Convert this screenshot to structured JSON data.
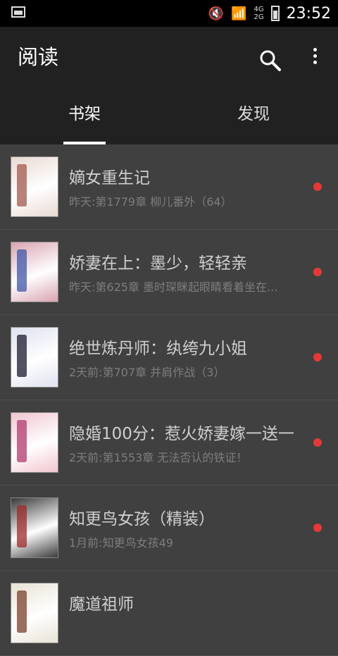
{
  "status": {
    "time": "23:52",
    "net_top": "4G",
    "net_bottom": "2G"
  },
  "app": {
    "title": "阅读"
  },
  "tabs": [
    {
      "label": "书架"
    },
    {
      "label": "发现"
    }
  ],
  "books": [
    {
      "title": "嫡女重生记",
      "sub": "昨天:第1779章 柳儿番外（64）",
      "cover": "#e9d9d2",
      "accent": "#a0584e"
    },
    {
      "title": "娇妻在上：墨少，轻轻亲",
      "sub": "昨天:第625章 墨时琛眯起眼睛看着坐在...",
      "cover": "#d9a4b0",
      "accent": "#3d55a6"
    },
    {
      "title": "绝世炼丹师：纨绔九小姐",
      "sub": "2天前:第707章 并肩作战（3）",
      "cover": "#dfe2ef",
      "accent": "#1a1a2e"
    },
    {
      "title": "隐婚100分：惹火娇妻嫁一送一",
      "sub": "2天前:第1553章 无法否认的铁证！",
      "cover": "#f1c6cf",
      "accent": "#b23a6f"
    },
    {
      "title": "知更鸟女孩（精装）",
      "sub": "1月前:知更鸟女孩49",
      "cover": "#3a3a3a",
      "accent": "#9c2a2a"
    },
    {
      "title": "魔道祖师",
      "sub": "",
      "cover": "#e9e3d6",
      "accent": "#7a3f2a"
    }
  ]
}
